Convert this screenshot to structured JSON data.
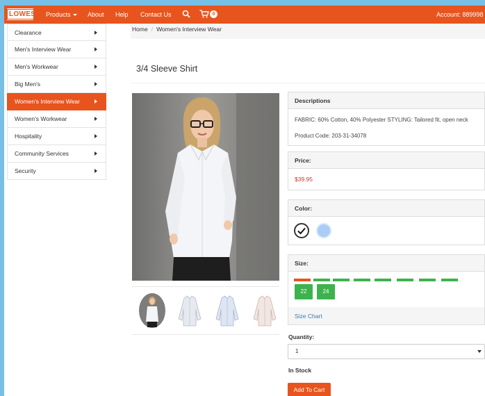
{
  "brand": {
    "logo_text": "LOWES",
    "accent": "#e8541d"
  },
  "nav": {
    "products": "Products",
    "about": "About",
    "help": "Help",
    "contact": "Contact Us",
    "cart_count": "0",
    "account": "Account: 889998"
  },
  "sidebar": {
    "items": [
      {
        "label": "Clearance"
      },
      {
        "label": "Men's Interview Wear"
      },
      {
        "label": "Men's Workwear"
      },
      {
        "label": "Big Men's"
      },
      {
        "label": "Women's Interview Wear",
        "active": true
      },
      {
        "label": "Women's Workwear"
      },
      {
        "label": "Hospitality"
      },
      {
        "label": "Community Services"
      },
      {
        "label": "Security"
      }
    ]
  },
  "breadcrumb": {
    "home": "Home",
    "current": "Women's Interview Wear"
  },
  "product": {
    "title": "3/4 Sleeve Shirt",
    "descriptions_label": "Descriptions",
    "description": "FABRIC: 60% Cotton, 40% Polyester STYLING: Tailored fit, open neck",
    "product_code": "Product Code: 203-31-34078",
    "price_label": "Price:",
    "price": "$39.95",
    "color_label": "Color:",
    "colors": [
      "#ffffff",
      "#a9cdf5"
    ],
    "size_label": "Size:",
    "sizes_visible": [
      "22",
      "24"
    ],
    "size_chart": "Size Chart",
    "quantity_label": "Quantity:",
    "quantity_value": "1",
    "stock": "In Stock",
    "add_to_cart": "Add To Cart"
  }
}
